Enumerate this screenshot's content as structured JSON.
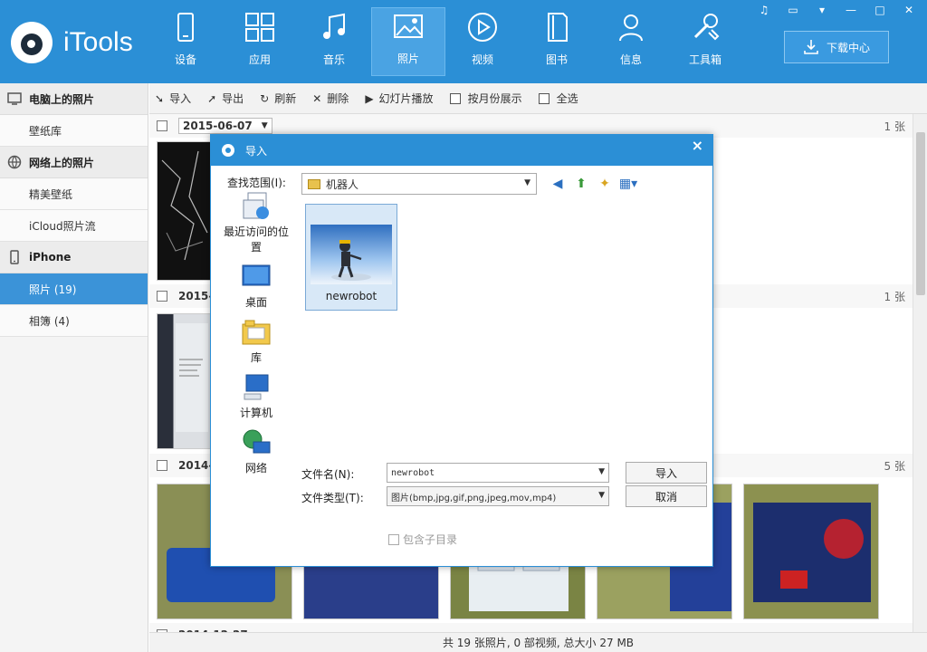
{
  "app": {
    "logo_text": "iTools"
  },
  "nav": [
    {
      "label": "设备",
      "icon": "device-icon"
    },
    {
      "label": "应用",
      "icon": "apps-icon"
    },
    {
      "label": "音乐",
      "icon": "music-icon"
    },
    {
      "label": "照片",
      "icon": "photo-icon",
      "active": true
    },
    {
      "label": "视频",
      "icon": "video-icon"
    },
    {
      "label": "图书",
      "icon": "book-icon"
    },
    {
      "label": "信息",
      "icon": "contact-icon"
    },
    {
      "label": "工具箱",
      "icon": "tools-icon"
    }
  ],
  "download_center": "下载中心",
  "window_controls": [
    "♫",
    "▭",
    "▾",
    "—",
    "□",
    "✕"
  ],
  "sidebar": {
    "sections": [
      {
        "title": "电脑上的照片",
        "icon": "monitor-icon",
        "items": [
          "壁纸库"
        ]
      },
      {
        "title": "网络上的照片",
        "icon": "globe-icon",
        "items": [
          "精美壁纸",
          "iCloud照片流"
        ]
      },
      {
        "title": "iPhone",
        "icon": "phone-icon",
        "items": [
          "照片 (19)",
          "相簿 (4)"
        ]
      }
    ],
    "active_item": "照片 (19)"
  },
  "toolbar": {
    "import": "导入",
    "export": "导出",
    "refresh": "刷新",
    "delete": "删除",
    "slideshow": "幻灯片播放",
    "by_month": "按月份展示",
    "select_all": "全选"
  },
  "groups": [
    {
      "date": "2015-06-07",
      "count": "1 张"
    },
    {
      "date": "2015-",
      "count": "1 张"
    },
    {
      "date": "2014-",
      "count": "5 张"
    },
    {
      "date": "2014-12-27",
      "count": ""
    }
  ],
  "status": "共 19 张照片, 0 部视频, 总大小 27 MB",
  "dialog": {
    "title": "导入",
    "look_in_label": "查找范围(I):",
    "look_in_value": "机器人",
    "places": [
      "最近访问的位置",
      "桌面",
      "库",
      "计算机",
      "网络"
    ],
    "file": {
      "name": "newrobot"
    },
    "filename_label": "文件名(N):",
    "filename_value": "newrobot",
    "filetype_label": "文件类型(T):",
    "filetype_value": "图片(bmp,jpg,gif,png,jpeg,mov,mp4)",
    "open_button": "导入",
    "cancel_button": "取消",
    "include_subdirs": "包含子目录"
  },
  "colors": {
    "accent": "#2b8fd6",
    "selected": "#3b93d8"
  }
}
